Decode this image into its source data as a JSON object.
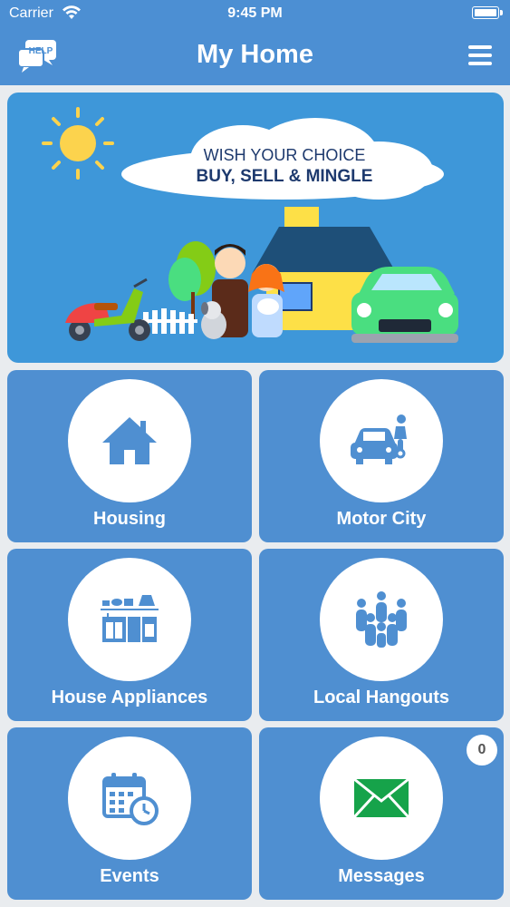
{
  "status_bar": {
    "carrier": "Carrier",
    "time": "9:45 PM"
  },
  "header": {
    "title": "My Home",
    "help_label": "HELP"
  },
  "banner": {
    "line1": "WISH YOUR CHOICE",
    "line2": "BUY, SELL & MINGLE"
  },
  "tiles": [
    {
      "label": "Housing",
      "icon": "house-icon"
    },
    {
      "label": "Motor City",
      "icon": "car-motorbike-icon"
    },
    {
      "label": "House Appliances",
      "icon": "kitchen-appliances-icon"
    },
    {
      "label": "Local Hangouts",
      "icon": "people-group-icon"
    },
    {
      "label": "Events",
      "icon": "calendar-clock-icon"
    },
    {
      "label": "Messages",
      "icon": "envelope-icon",
      "badge": "0"
    }
  ],
  "colors": {
    "primary": "#4c8fd3",
    "tile": "#4f8fd1",
    "banner": "#3e97d9",
    "message_green": "#16a34a"
  }
}
